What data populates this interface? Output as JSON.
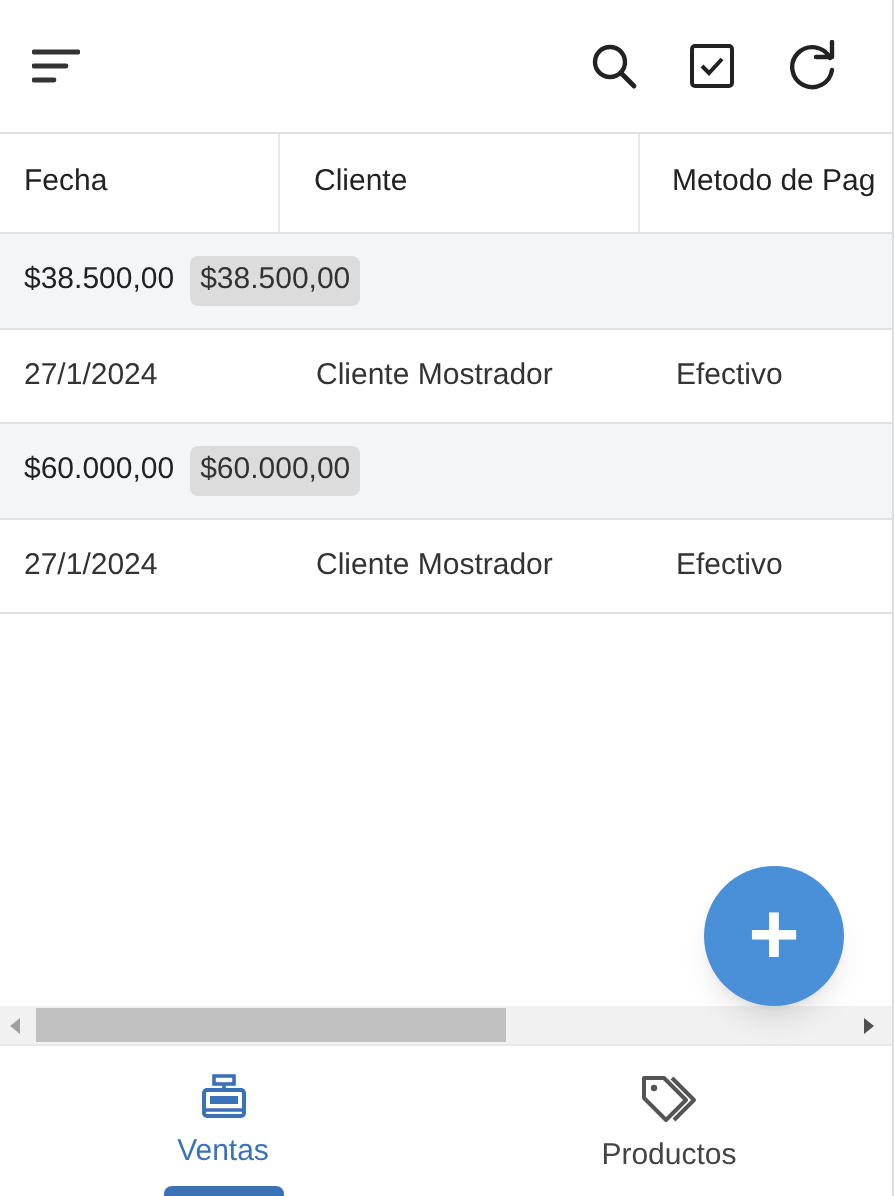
{
  "table": {
    "columns": [
      "Fecha",
      "Cliente",
      "Metodo de Pag"
    ],
    "groups": [
      {
        "total": "$38.500,00",
        "badge": "$38.500,00",
        "rows": [
          {
            "fecha": "27/1/2024",
            "cliente": "Cliente Mostrador",
            "metodo": "Efectivo"
          }
        ]
      },
      {
        "total": "$60.000,00",
        "badge": "$60.000,00",
        "rows": [
          {
            "fecha": "27/1/2024",
            "cliente": "Cliente Mostrador",
            "metodo": "Efectivo"
          }
        ]
      }
    ]
  },
  "fab": {
    "label": "+"
  },
  "bottom_nav": [
    {
      "kind": "register",
      "label": "Ventas",
      "selected": true
    },
    {
      "kind": "tags",
      "label": "Productos",
      "selected": false
    }
  ]
}
